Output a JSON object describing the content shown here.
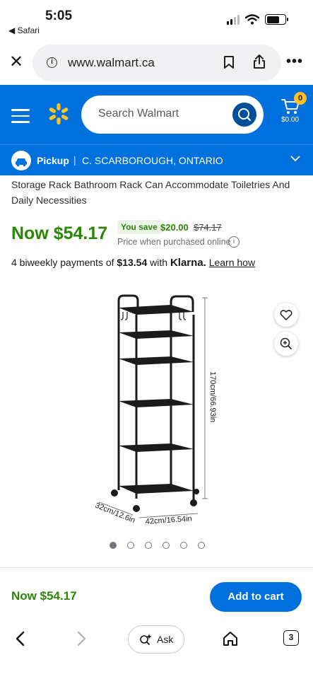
{
  "status_bar": {
    "time": "5:05",
    "back_app": "◀ Safari"
  },
  "browser": {
    "url": "www.walmart.ca",
    "tabs_count": "3",
    "ask_label": "Ask"
  },
  "header": {
    "search_placeholder": "Search Walmart",
    "cart_count": "0",
    "cart_total": "$0.00"
  },
  "pickup": {
    "label": "Pickup",
    "separator": "|",
    "location": "C. SCARBOROUGH, ONTARIO"
  },
  "product": {
    "title_continued": "Storage Rack Bathroom Rack Can Accommodate Toiletries And Daily Necessities",
    "price_now": "Now $54.17",
    "you_save_label": "You save",
    "save_amount": "$20.00",
    "original_price": "$74.17",
    "price_note": "Price when purchased online",
    "klarna_prefix": "4 biweekly payments of",
    "klarna_amount": "$13.54",
    "klarna_with": "with",
    "klarna_brand": "Klarna.",
    "learn_how": "Learn how",
    "image_labels": {
      "height": "170cm/66.93in",
      "depth": "32cm/12.6in",
      "width": "42cm/16.54in"
    },
    "carousel": {
      "count": 6,
      "active_index": 0
    }
  },
  "sticky": {
    "price": "Now $54.17",
    "add_to_cart": "Add to cart"
  },
  "colors": {
    "walmart_blue": "#0071dc",
    "spark_yellow": "#ffc220",
    "price_green": "#2a8703"
  }
}
